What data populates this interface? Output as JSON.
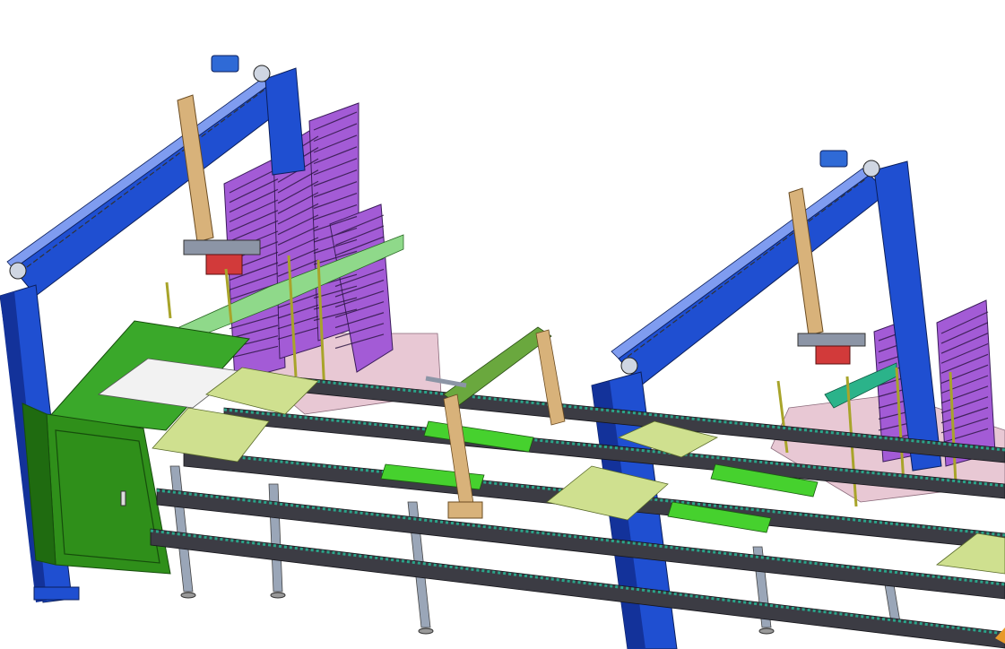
{
  "scene": {
    "kind": "3D CAD assembly render — automated conveyor line with gantry pick-and-place stations",
    "stations": [
      "left-gantry-station",
      "right-gantry-station"
    ],
    "colors": {
      "background": "#ffffff",
      "gantry_frame": "#1f4fd1",
      "gantry_frame_dark": "#13329a",
      "rack": "#a35bd6",
      "rack_dark": "#5a2a86",
      "control_cabinet": "#2f8f1a",
      "control_cabinet_dark": "#1f6b10",
      "pallet_plate": "#cfe08f",
      "fixture_green": "#46d12e",
      "conveyor_rail": "#3c3c44",
      "conveyor_chain": "#2aa58a",
      "column_tan": "#d8b27a",
      "floor_pink": "#e8c8d4",
      "support_leg": "#9aa6b8",
      "guard_yellow": "#d8d44a",
      "motor_blue": "#2f6ad6"
    }
  }
}
